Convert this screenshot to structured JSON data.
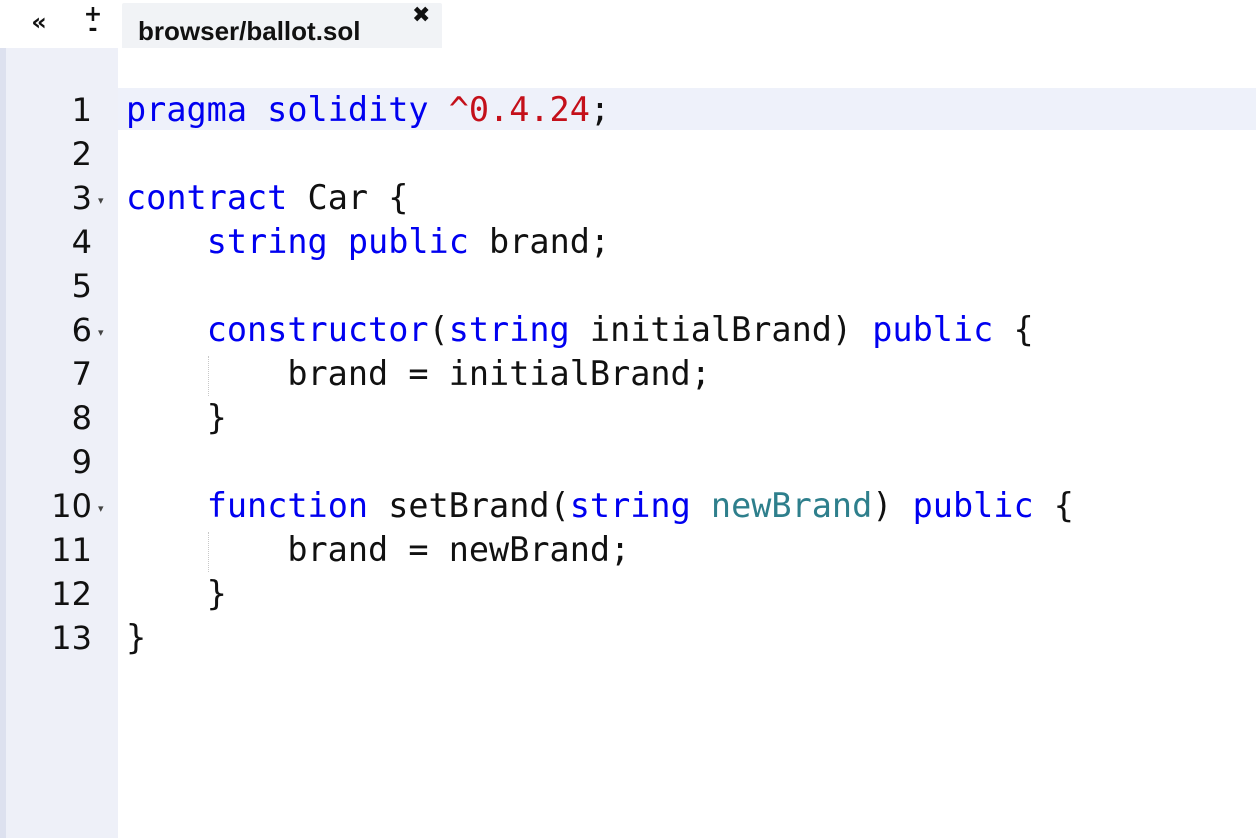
{
  "toolbar": {
    "collapse_icon": "double-chevron-left-icon",
    "collapse_glyph": "«",
    "zoom_plus": "+",
    "zoom_minus": "-"
  },
  "tab": {
    "label": "browser/ballot.sol",
    "close_glyph": "✖"
  },
  "editor": {
    "lines": [
      {
        "n": "1",
        "tokens": [
          [
            "kw",
            "pragma"
          ],
          [
            "",
            ""
          ],
          [
            "kw",
            " solidity"
          ],
          [
            "num",
            " ^0.4.24"
          ],
          [
            "",
            ";"
          ]
        ]
      },
      {
        "n": "2",
        "tokens": []
      },
      {
        "n": "3",
        "fold": true,
        "tokens": [
          [
            "kw",
            "contract"
          ],
          [
            "",
            " Car {"
          ]
        ]
      },
      {
        "n": "4",
        "tokens": [
          [
            "",
            "    "
          ],
          [
            "kw",
            "string"
          ],
          [
            "",
            " "
          ],
          [
            "kw",
            "public"
          ],
          [
            "",
            " brand;"
          ]
        ]
      },
      {
        "n": "5",
        "tokens": []
      },
      {
        "n": "6",
        "fold": true,
        "tokens": [
          [
            "",
            "    "
          ],
          [
            "kw",
            "constructor"
          ],
          [
            "",
            "("
          ],
          [
            "kw",
            "string"
          ],
          [
            "",
            " initialBrand) "
          ],
          [
            "kw",
            "public"
          ],
          [
            "",
            " {"
          ]
        ]
      },
      {
        "n": "7",
        "guide": true,
        "tokens": [
          [
            "",
            "        brand = initialBrand;"
          ]
        ]
      },
      {
        "n": "8",
        "tokens": [
          [
            "",
            "    }"
          ]
        ]
      },
      {
        "n": "9",
        "tokens": []
      },
      {
        "n": "10",
        "fold": true,
        "tokens": [
          [
            "",
            "    "
          ],
          [
            "kw",
            "function"
          ],
          [
            "",
            " setBrand("
          ],
          [
            "kw",
            "string"
          ],
          [
            "",
            " "
          ],
          [
            "param",
            "newBrand"
          ],
          [
            "",
            ") "
          ],
          [
            "kw",
            "public"
          ],
          [
            "",
            " {"
          ]
        ]
      },
      {
        "n": "11",
        "guide": true,
        "tokens": [
          [
            "",
            "        brand = newBrand;"
          ]
        ]
      },
      {
        "n": "12",
        "tokens": [
          [
            "",
            "    }"
          ]
        ]
      },
      {
        "n": "13",
        "tokens": [
          [
            "",
            "}"
          ]
        ]
      }
    ]
  },
  "colors": {
    "keyword": "#0000f0",
    "number": "#c4101a",
    "parameter": "#2e7f8c",
    "gutter": "#eef0f8",
    "active_line": "#eef1fa"
  }
}
